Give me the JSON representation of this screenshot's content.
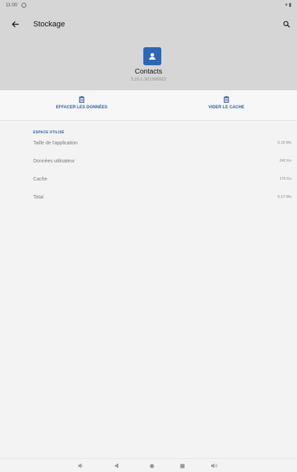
{
  "status_bar": {
    "time": "11:00",
    "right_icons": "▾ ▮"
  },
  "header": {
    "title": "Stockage"
  },
  "app": {
    "name": "Contacts",
    "version": "3.20.1.301393922"
  },
  "actions": [
    {
      "label": "EFFACER LES DONNÉES",
      "icon": "trash-icon"
    },
    {
      "label": "VIDER LE CACHE",
      "icon": "trash-icon"
    }
  ],
  "storage": {
    "section_title": "ESPACE UTILISÉ",
    "rows": [
      {
        "label": "Taille de l'application",
        "value": "6,15 Mo"
      },
      {
        "label": "Données utilisateur",
        "value": "242 Ko"
      },
      {
        "label": "Cache",
        "value": "176 Ko"
      },
      {
        "label": "Total",
        "value": "6,57 Mo"
      }
    ]
  },
  "colors": {
    "accent": "#2a5aa8",
    "app_icon": "#2e66b6",
    "header_bg": "#d6d6d6"
  },
  "nav_bar": [
    "volume-down-icon",
    "back-icon",
    "home-icon",
    "recents-icon",
    "volume-up-icon"
  ]
}
